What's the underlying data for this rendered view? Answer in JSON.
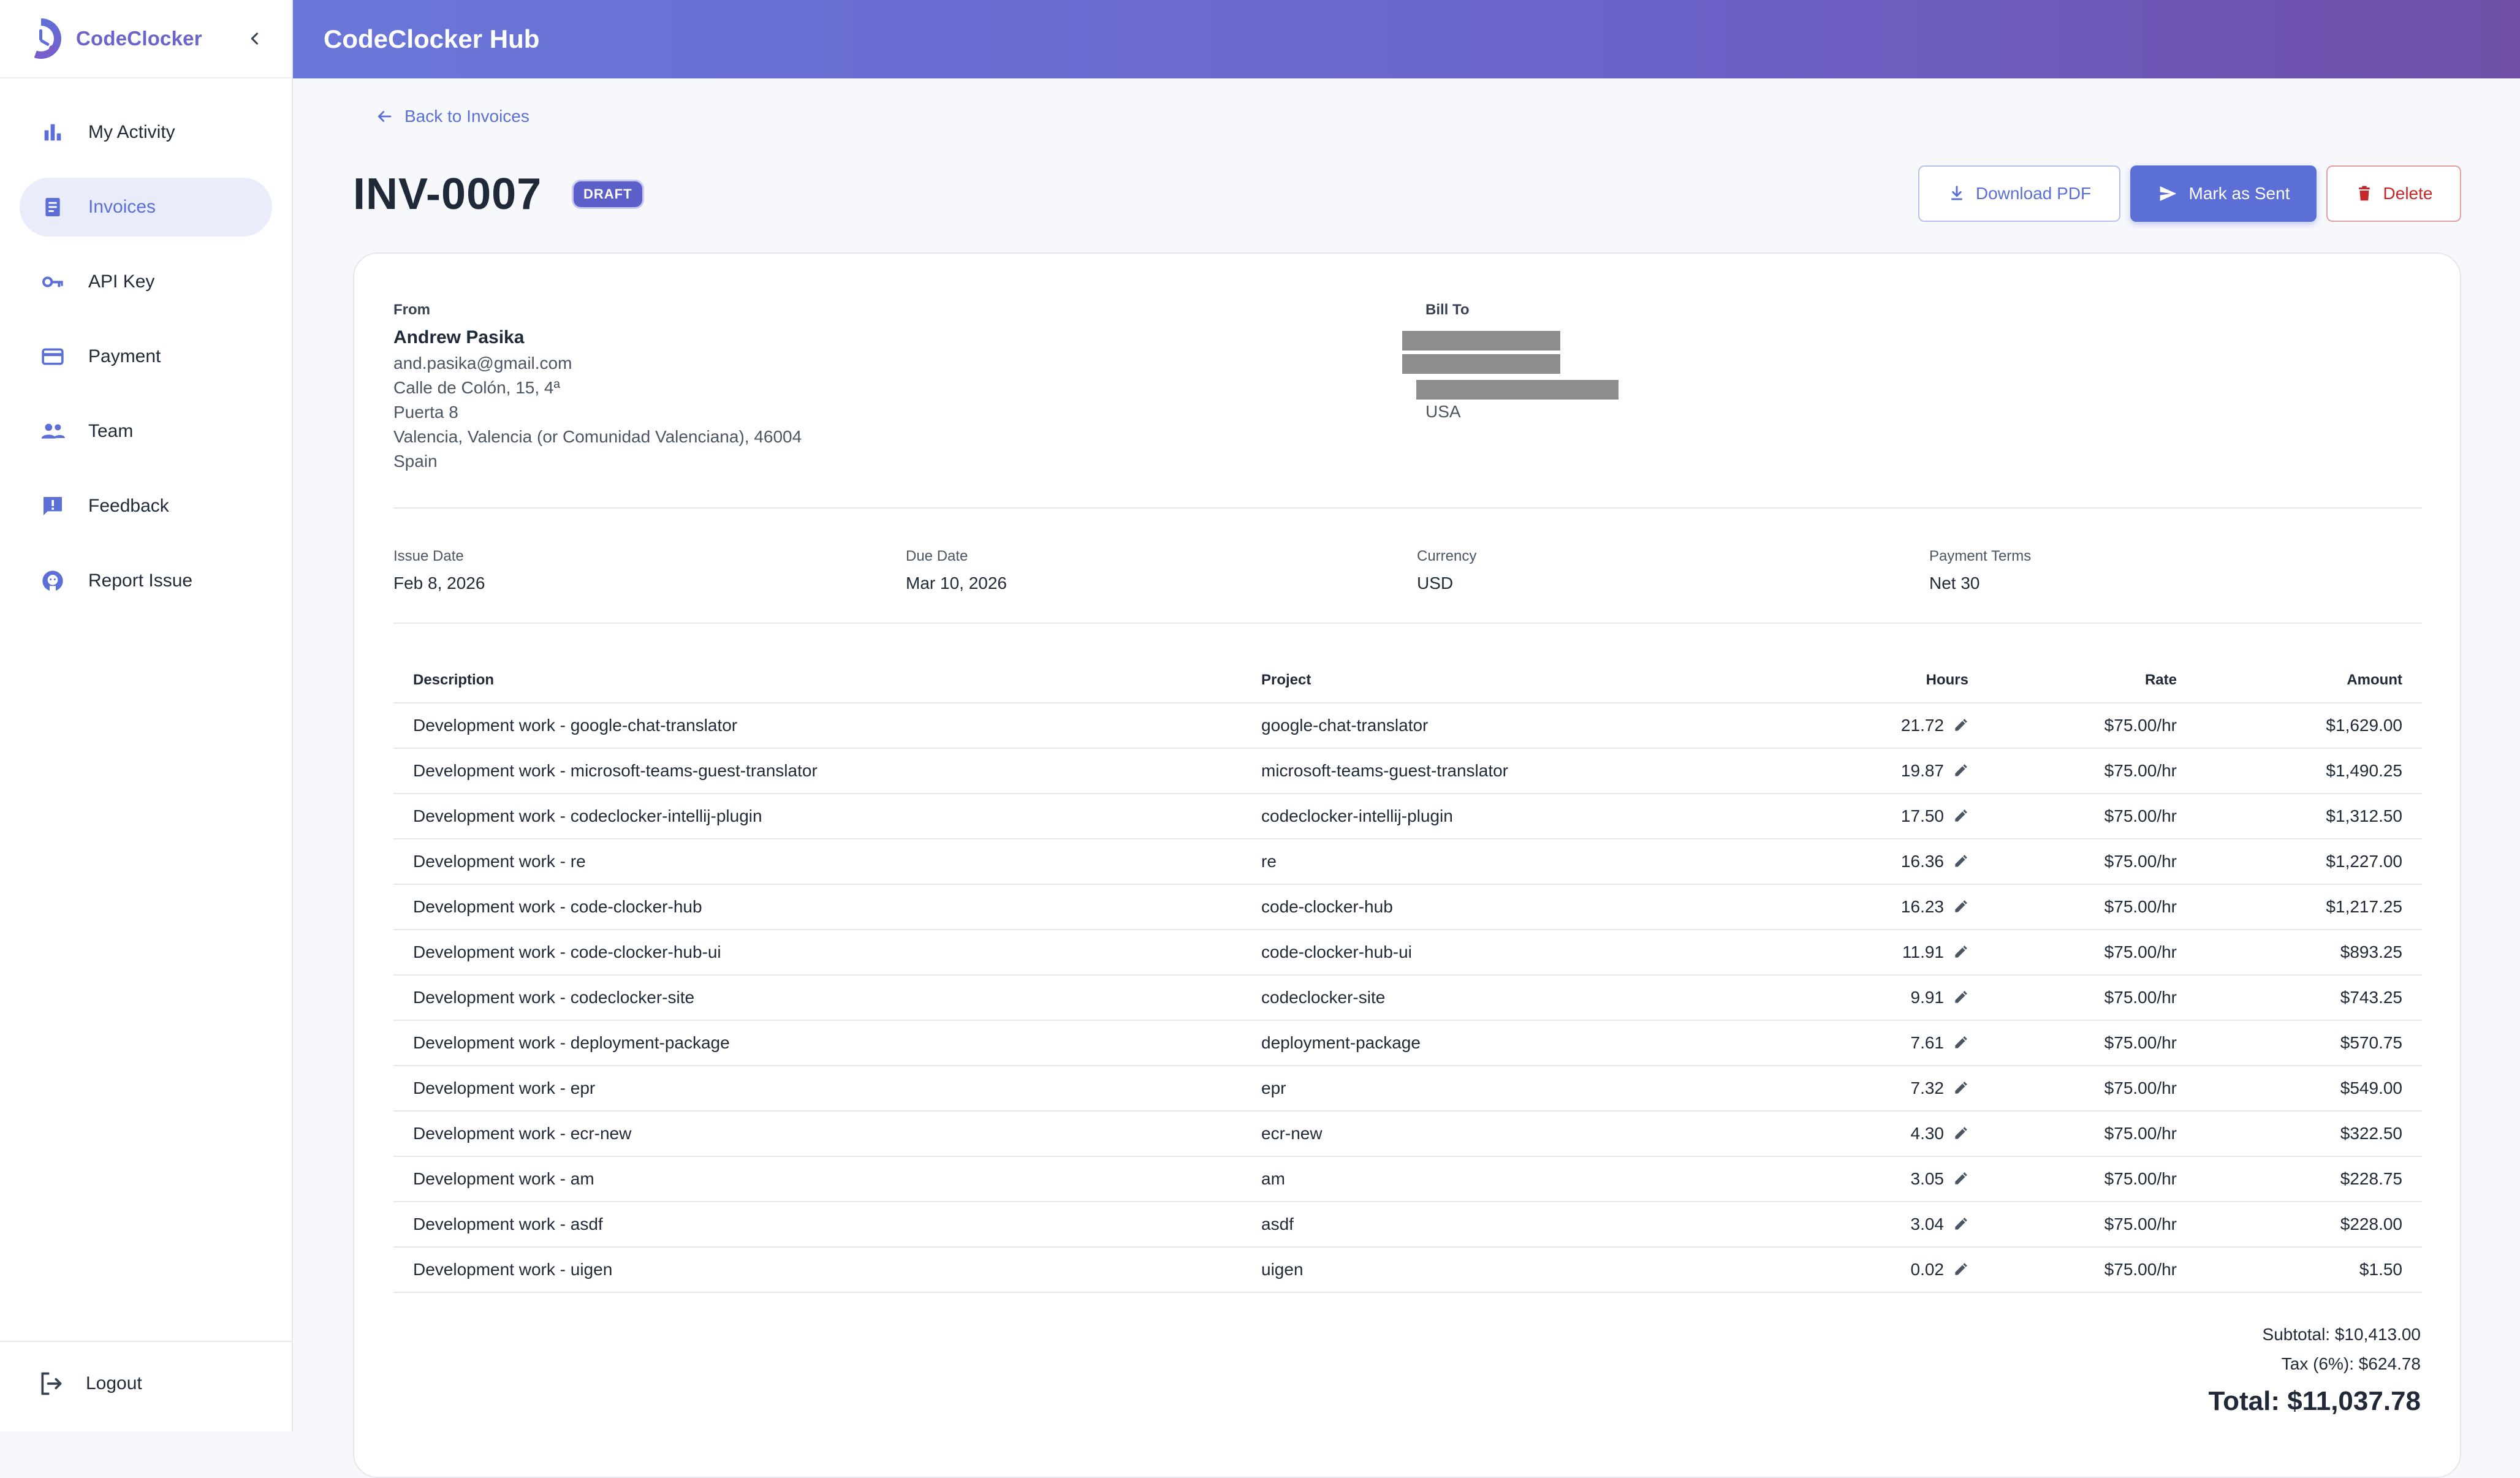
{
  "app": {
    "brand": "CodeClocker",
    "header_title": "CodeClocker Hub"
  },
  "sidebar": {
    "items": [
      {
        "label": "My Activity",
        "icon": "bar-chart-icon",
        "active": false
      },
      {
        "label": "Invoices",
        "icon": "receipt-icon",
        "active": true
      },
      {
        "label": "API Key",
        "icon": "key-icon",
        "active": false
      },
      {
        "label": "Payment",
        "icon": "credit-card-icon",
        "active": false
      },
      {
        "label": "Team",
        "icon": "people-icon",
        "active": false
      },
      {
        "label": "Feedback",
        "icon": "feedback-icon",
        "active": false
      },
      {
        "label": "Report Issue",
        "icon": "github-icon",
        "active": false
      }
    ],
    "logout_label": "Logout"
  },
  "page": {
    "back_label": "Back to Invoices",
    "invoice_number": "INV-0007",
    "status_badge": "DRAFT",
    "actions": {
      "download": "Download PDF",
      "mark_sent": "Mark as Sent",
      "delete": "Delete"
    }
  },
  "invoice": {
    "from_label": "From",
    "from": {
      "name": "Andrew Pasika",
      "email": "and.pasika@gmail.com",
      "address1": "Calle de Colón, 15, 4ª",
      "address2": "Puerta 8",
      "city_line": "Valencia, Valencia (or Comunidad Valenciana), 46004",
      "country": "Spain"
    },
    "bill_to_label": "Bill To",
    "bill_to_country": "USA",
    "meta": {
      "issue_date_label": "Issue Date",
      "issue_date": "Feb 8, 2026",
      "due_date_label": "Due Date",
      "due_date": "Mar 10, 2026",
      "currency_label": "Currency",
      "currency": "USD",
      "payment_terms_label": "Payment Terms",
      "payment_terms": "Net 30"
    },
    "columns": [
      "Description",
      "Project",
      "Hours",
      "Rate",
      "Amount"
    ],
    "rows": [
      {
        "description": "Development work - google-chat-translator",
        "project": "google-chat-translator",
        "hours": "21.72",
        "rate": "$75.00/hr",
        "amount": "$1,629.00"
      },
      {
        "description": "Development work - microsoft-teams-guest-translator",
        "project": "microsoft-teams-guest-translator",
        "hours": "19.87",
        "rate": "$75.00/hr",
        "amount": "$1,490.25"
      },
      {
        "description": "Development work - codeclocker-intellij-plugin",
        "project": "codeclocker-intellij-plugin",
        "hours": "17.50",
        "rate": "$75.00/hr",
        "amount": "$1,312.50"
      },
      {
        "description": "Development work - re",
        "project": "re",
        "hours": "16.36",
        "rate": "$75.00/hr",
        "amount": "$1,227.00"
      },
      {
        "description": "Development work - code-clocker-hub",
        "project": "code-clocker-hub",
        "hours": "16.23",
        "rate": "$75.00/hr",
        "amount": "$1,217.25"
      },
      {
        "description": "Development work - code-clocker-hub-ui",
        "project": "code-clocker-hub-ui",
        "hours": "11.91",
        "rate": "$75.00/hr",
        "amount": "$893.25"
      },
      {
        "description": "Development work - codeclocker-site",
        "project": "codeclocker-site",
        "hours": "9.91",
        "rate": "$75.00/hr",
        "amount": "$743.25"
      },
      {
        "description": "Development work - deployment-package",
        "project": "deployment-package",
        "hours": "7.61",
        "rate": "$75.00/hr",
        "amount": "$570.75"
      },
      {
        "description": "Development work - epr",
        "project": "epr",
        "hours": "7.32",
        "rate": "$75.00/hr",
        "amount": "$549.00"
      },
      {
        "description": "Development work - ecr-new",
        "project": "ecr-new",
        "hours": "4.30",
        "rate": "$75.00/hr",
        "amount": "$322.50"
      },
      {
        "description": "Development work - am",
        "project": "am",
        "hours": "3.05",
        "rate": "$75.00/hr",
        "amount": "$228.75"
      },
      {
        "description": "Development work - asdf",
        "project": "asdf",
        "hours": "3.04",
        "rate": "$75.00/hr",
        "amount": "$228.00"
      },
      {
        "description": "Development work - uigen",
        "project": "uigen",
        "hours": "0.02",
        "rate": "$75.00/hr",
        "amount": "$1.50"
      }
    ],
    "totals": {
      "subtotal": "Subtotal: $10,413.00",
      "tax": "Tax (6%): $624.78",
      "total": "Total: $11,037.78"
    }
  },
  "colors": {
    "accent": "#5b6fd6",
    "header_gradient_start": "#6a77d9",
    "header_gradient_end": "#6f4fa8",
    "delete": "#c62828",
    "badge": "#5b5fc7"
  }
}
